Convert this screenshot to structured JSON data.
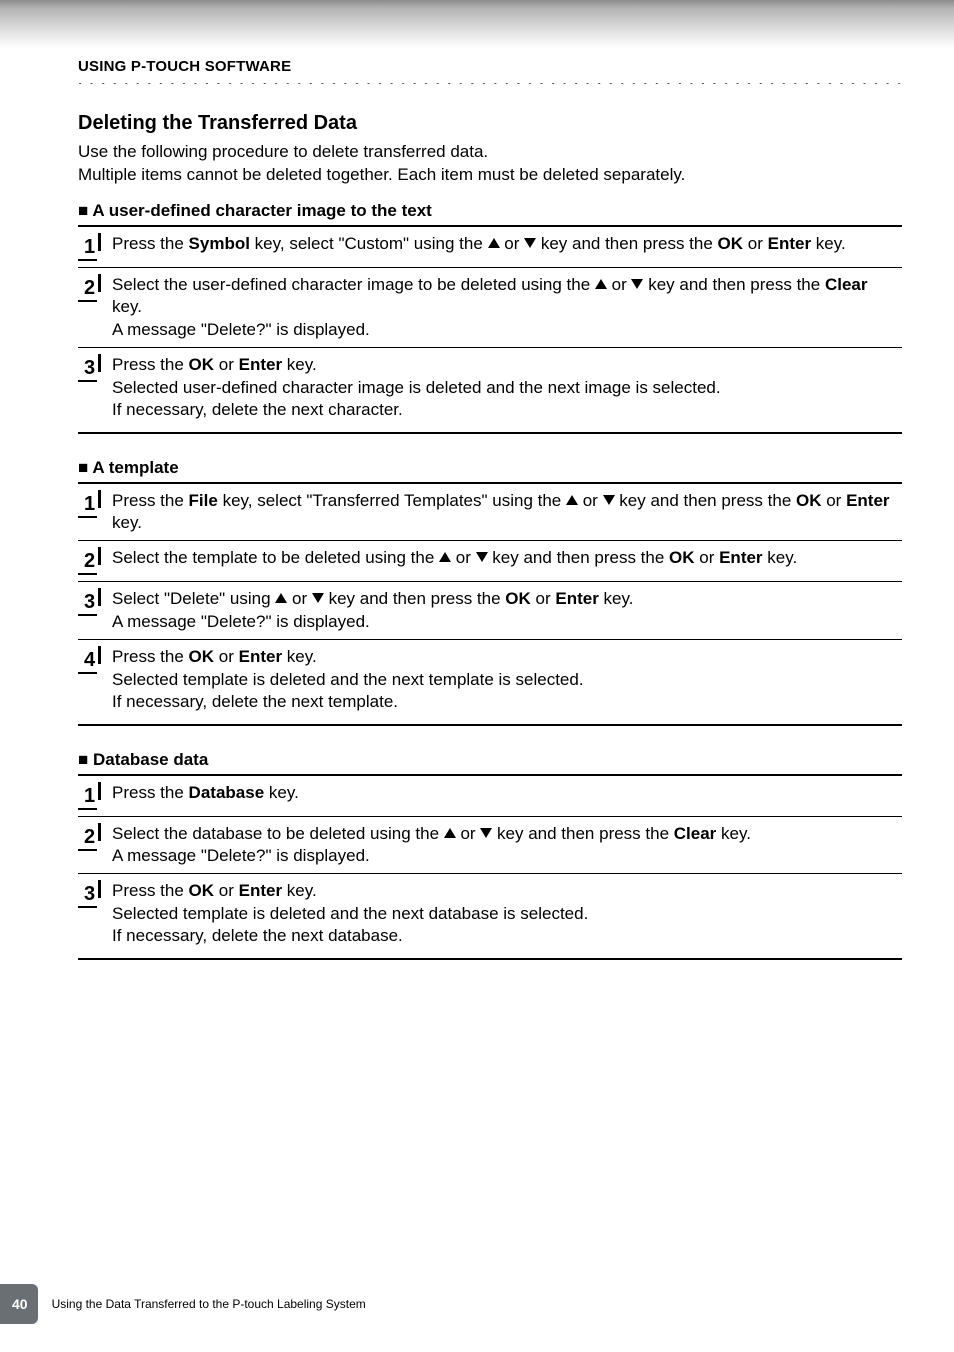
{
  "chapter": "USING P-TOUCH SOFTWARE",
  "title": "Deleting the Transferred Data",
  "intro1": "Use the following procedure to delete transferred data.",
  "intro2": "Multiple items cannot be deleted together. Each item must be deleted separately.",
  "sections": [
    {
      "heading": "A user-defined character image to the text",
      "steps": [
        {
          "n": "1",
          "parts": [
            "Press the ",
            "Symbol",
            " key, select \"Custom\" using the ",
            "UP",
            " or ",
            "DOWN",
            " key and then press the ",
            "OK",
            " or ",
            "Enter",
            " key."
          ]
        },
        {
          "n": "2",
          "parts": [
            "Select the user-defined character image to be deleted using the ",
            "UP",
            " or ",
            "DOWN",
            " key and then press the ",
            "Clear",
            " key.\nA message \"Delete?\" is displayed."
          ]
        },
        {
          "n": "3",
          "parts": [
            "Press the ",
            "OK",
            " or ",
            "Enter",
            " key.\nSelected user-defined character image is deleted and the next image is selected.\nIf necessary, delete the next character."
          ]
        }
      ]
    },
    {
      "heading": "A template",
      "steps": [
        {
          "n": "1",
          "parts": [
            "Press the ",
            "File",
            " key, select \"Transferred Templates\" using the ",
            "UP",
            " or ",
            "DOWN",
            " key and then press the ",
            "OK",
            " or ",
            "Enter",
            " key."
          ]
        },
        {
          "n": "2",
          "parts": [
            "Select the template to be deleted using the ",
            "UP",
            " or ",
            "DOWN",
            " key and then press the ",
            "OK",
            " or ",
            "Enter",
            " key."
          ]
        },
        {
          "n": "3",
          "parts": [
            "Select \"Delete\" using ",
            "UP",
            " or ",
            "DOWN",
            " key and then press the ",
            "OK",
            " or ",
            "Enter",
            " key.\nA message \"Delete?\" is displayed."
          ]
        },
        {
          "n": "4",
          "parts": [
            "Press the ",
            "OK",
            " or ",
            "Enter",
            " key.\nSelected template is deleted and the next template is selected.\nIf necessary, delete the next template."
          ]
        }
      ]
    },
    {
      "heading": "Database data",
      "steps": [
        {
          "n": "1",
          "parts": [
            "Press the ",
            "Database",
            " key."
          ]
        },
        {
          "n": "2",
          "parts": [
            "Select the database to be deleted using the ",
            "UP",
            " or ",
            "DOWN",
            " key and then press the ",
            "Clear",
            " key.\nA message \"Delete?\" is displayed."
          ]
        },
        {
          "n": "3",
          "parts": [
            "Press the ",
            "OK",
            " or ",
            "Enter",
            " key.\nSelected template is deleted and the next database is selected.\nIf necessary, delete the next database."
          ]
        }
      ]
    }
  ],
  "pageNumber": "40",
  "footerText": "Using the Data Transferred to the P-touch Labeling System",
  "boldKeys": [
    "Symbol",
    "OK",
    "Enter",
    "Clear",
    "File",
    "Database"
  ]
}
